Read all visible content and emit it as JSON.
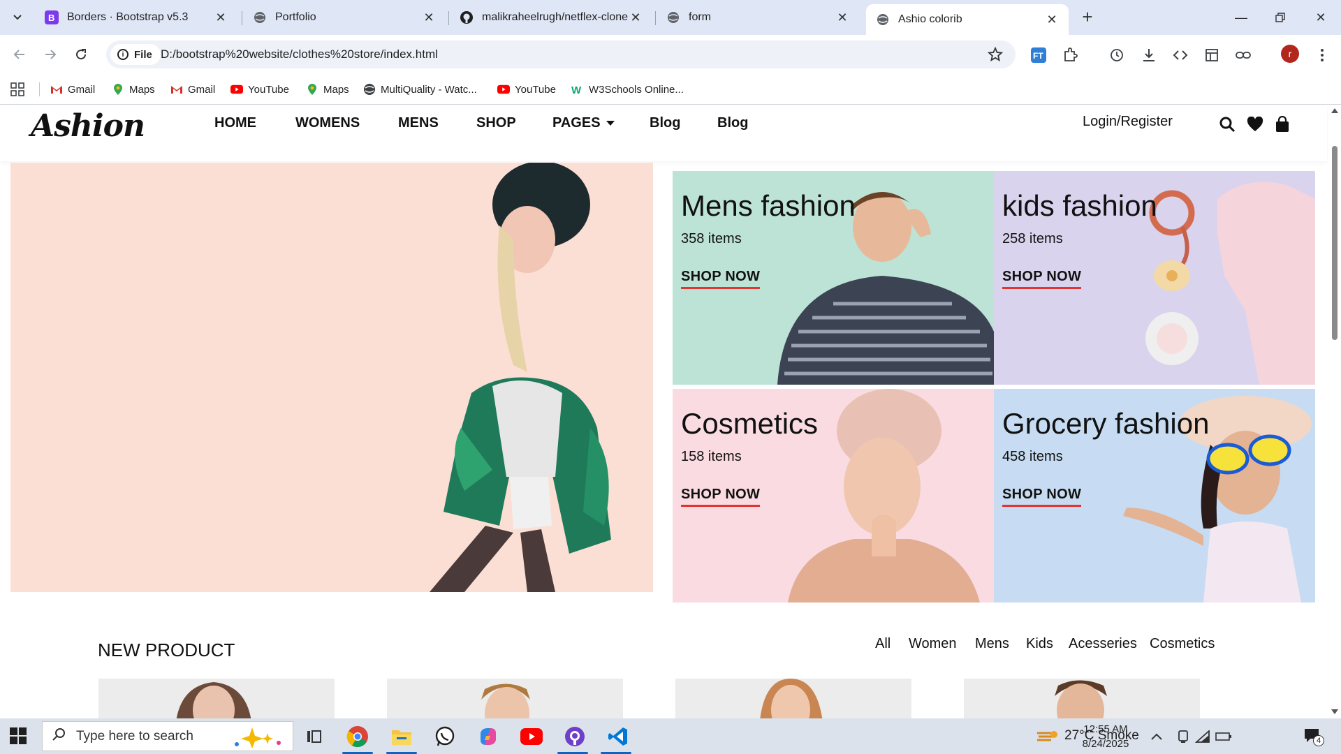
{
  "browser": {
    "tabs": [
      {
        "title": "Borders · Bootstrap v5.3",
        "favicon": "bootstrap-icon",
        "active": false
      },
      {
        "title": "Portfolio",
        "favicon": "globe-icon",
        "active": false
      },
      {
        "title": "malikraheelrugh/netflex-clone:",
        "favicon": "github-icon",
        "active": false
      },
      {
        "title": "form",
        "favicon": "globe-icon",
        "active": false
      },
      {
        "title": "Ashio colorib",
        "favicon": "globe-icon",
        "active": true
      }
    ],
    "address": {
      "scheme_label": "File",
      "url": "D:/bootstrap%20website/clothes%20store/index.html"
    },
    "profile_initial": "r",
    "bookmarks": [
      {
        "label": "Gmail",
        "icon": "gmail-icon"
      },
      {
        "label": "Maps",
        "icon": "maps-icon"
      },
      {
        "label": "Gmail",
        "icon": "gmail-icon"
      },
      {
        "label": "YouTube",
        "icon": "youtube-icon"
      },
      {
        "label": "Maps",
        "icon": "maps-icon"
      },
      {
        "label": "MultiQuality - Watc...",
        "icon": "globe-icon"
      },
      {
        "label": "YouTube",
        "icon": "youtube-icon"
      },
      {
        "label": "W3Schools Online...",
        "icon": "w3schools-icon"
      }
    ]
  },
  "site": {
    "logo": "Ashion",
    "nav": [
      "HOME",
      "WOMENS",
      "MENS",
      "SHOP",
      "PAGES",
      "Blog",
      "Blog"
    ],
    "login": "Login/Register",
    "categories": [
      {
        "title": "Mens fashion",
        "count": "358 items",
        "link": "SHOP NOW",
        "bg": "#bde3d7"
      },
      {
        "title": "kids fashion",
        "count": "258 items",
        "link": "SHOP NOW",
        "bg": "#d9d3ee"
      },
      {
        "title": "Cosmetics",
        "count": "158 items",
        "link": "SHOP NOW",
        "bg": "#fadbe2"
      },
      {
        "title": "Grocery fashion",
        "count": "458 items",
        "link": "SHOP NOW",
        "bg": "#c7dcf2"
      }
    ],
    "new_product": {
      "title": "NEW PRODUCT",
      "filters": [
        "All",
        "Women",
        "Mens",
        "Kids",
        "Acesseries",
        "Cosmetics"
      ]
    },
    "accent_color": "#e3342f"
  },
  "taskbar": {
    "search_placeholder": "Type here to search",
    "weather": "27°C  Smoke",
    "time": "12:55 AM",
    "date": "8/24/2025",
    "notification_count": "4"
  }
}
